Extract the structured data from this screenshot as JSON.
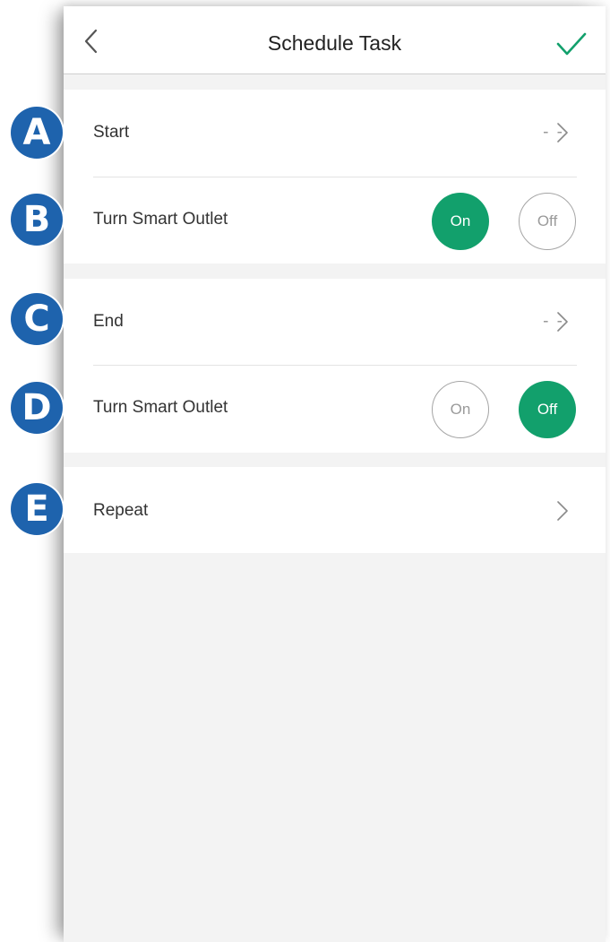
{
  "header": {
    "title": "Schedule Task",
    "back_icon": "chevron-left-icon",
    "confirm_icon": "checkmark-icon",
    "confirm_color": "#12a06c"
  },
  "start_section": {
    "start": {
      "label": "Start",
      "value": "- -"
    },
    "action": {
      "label": "Turn Smart Outlet",
      "on_label": "On",
      "off_label": "Off",
      "selected": "On"
    }
  },
  "end_section": {
    "end": {
      "label": "End",
      "value": "- -"
    },
    "action": {
      "label": "Turn Smart Outlet",
      "on_label": "On",
      "off_label": "Off",
      "selected": "Off"
    }
  },
  "repeat_section": {
    "repeat": {
      "label": "Repeat"
    }
  },
  "callouts": [
    "A",
    "B",
    "C",
    "D",
    "E"
  ],
  "colors": {
    "accent_green": "#12a06c",
    "callout_blue": "#1e63ad",
    "background": "#f3f3f3"
  }
}
